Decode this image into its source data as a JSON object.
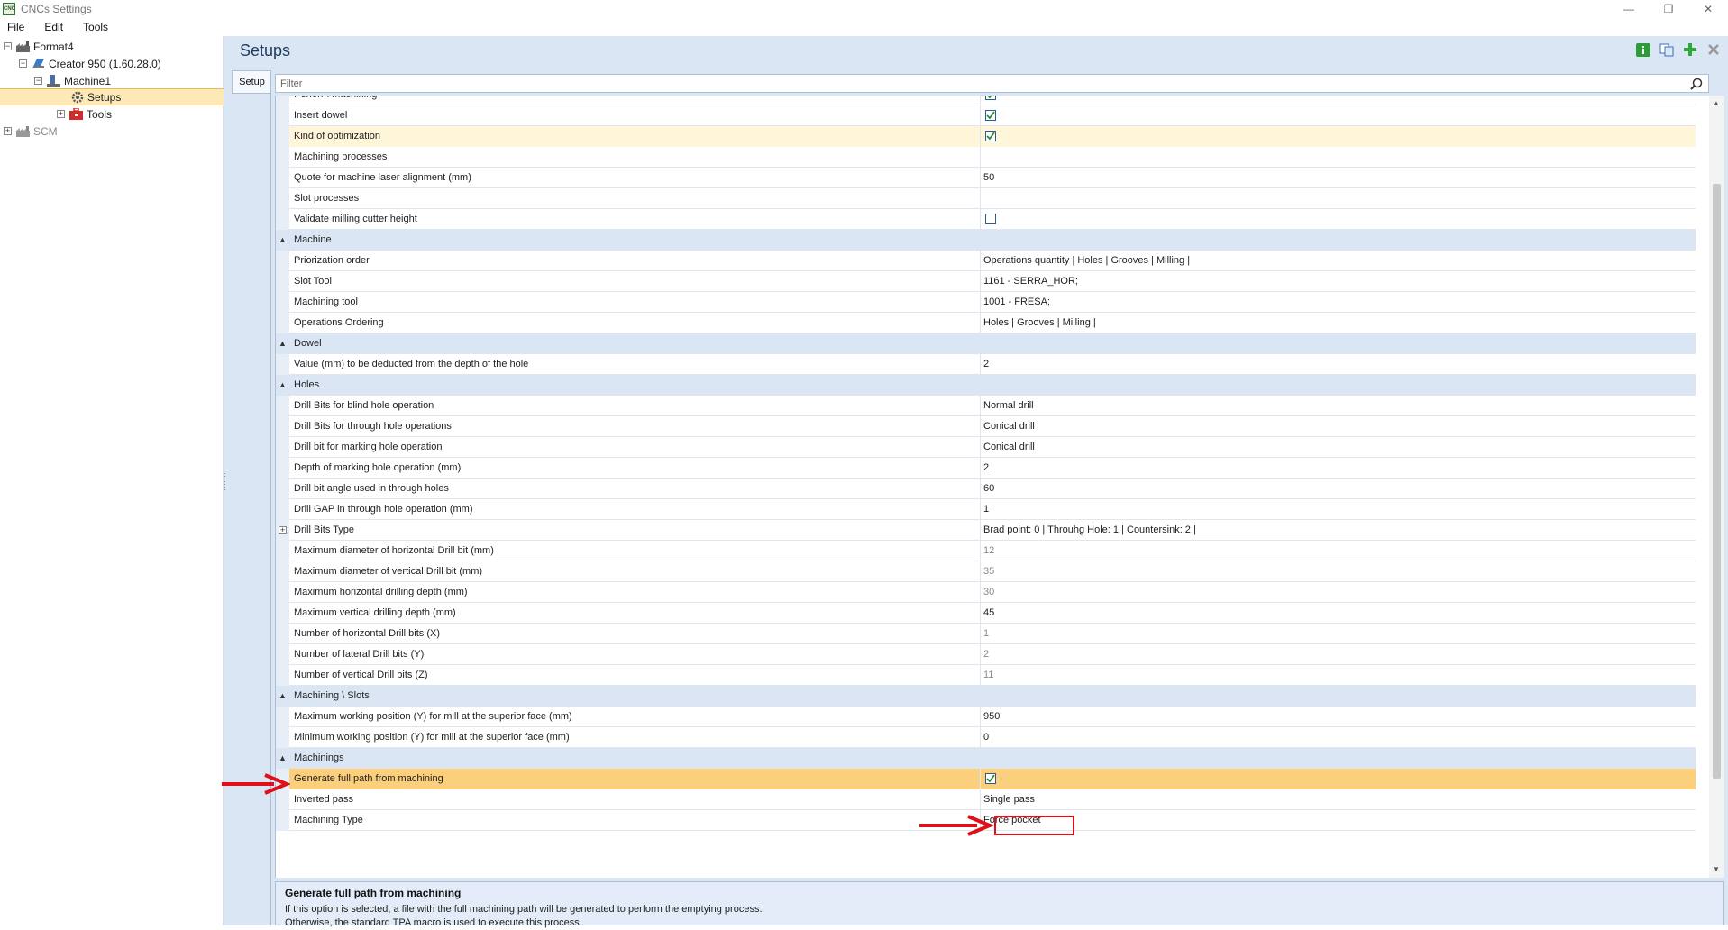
{
  "window": {
    "title": "CNCs Settings",
    "icon_text": "CNC"
  },
  "menu": [
    "File",
    "Edit",
    "Tools"
  ],
  "tree": {
    "format4": "Format4",
    "creator": "Creator 950 (1.60.28.0)",
    "machine": "Machine1",
    "setups": "Setups",
    "tools": "Tools",
    "scm": "SCM"
  },
  "main": {
    "title": "Setups",
    "tab": "Setup",
    "filter_placeholder": "Filter"
  },
  "rows": [
    {
      "type": "prop",
      "name": "Perform machining",
      "check": true
    },
    {
      "type": "prop",
      "name": "Insert dowel",
      "check": true
    },
    {
      "type": "prop",
      "name": "Kind of optimization",
      "check": true,
      "hl": true
    },
    {
      "type": "prop",
      "name": "Machining processes",
      "value": ""
    },
    {
      "type": "prop",
      "name": "Quote for machine laser alignment (mm)",
      "value": "50"
    },
    {
      "type": "prop",
      "name": "Slot processes",
      "value": ""
    },
    {
      "type": "prop",
      "name": "Validate milling cutter height",
      "check": false
    },
    {
      "type": "cat",
      "name": "Machine"
    },
    {
      "type": "prop",
      "name": "Priorization order",
      "value": "Operations quantity | Holes | Grooves | Milling |"
    },
    {
      "type": "prop",
      "name": "Slot Tool",
      "value": "1161 - SERRA_HOR;"
    },
    {
      "type": "prop",
      "name": "Machining tool",
      "value": "1001 - FRESA;"
    },
    {
      "type": "prop",
      "name": "Operations Ordering",
      "value": "Holes | Grooves | Milling |"
    },
    {
      "type": "cat",
      "name": "Dowel"
    },
    {
      "type": "prop",
      "name": "Value (mm) to be deducted from the depth of the hole",
      "value": "2"
    },
    {
      "type": "cat",
      "name": "Holes"
    },
    {
      "type": "prop",
      "name": "Drill Bits for blind hole operation",
      "value": "Normal drill"
    },
    {
      "type": "prop",
      "name": "Drill Bits for through hole operations",
      "value": "Conical drill"
    },
    {
      "type": "prop",
      "name": "Drill bit for marking hole operation",
      "value": "Conical drill"
    },
    {
      "type": "prop",
      "name": "Depth of marking hole operation (mm)",
      "value": "2"
    },
    {
      "type": "prop",
      "name": "Drill bit angle used in through holes",
      "value": "60"
    },
    {
      "type": "prop",
      "name": "Drill GAP in through hole operation (mm)",
      "value": "1"
    },
    {
      "type": "prop",
      "name": "Drill Bits Type",
      "value": "Brad point: 0  |  Throuhg Hole: 1  |  Countersink: 2  |",
      "expand": true
    },
    {
      "type": "prop",
      "name": "Maximum diameter of horizontal Drill bit (mm)",
      "value": "12",
      "grey": true
    },
    {
      "type": "prop",
      "name": "Maximum diameter of vertical Drill bit (mm)",
      "value": "35",
      "grey": true
    },
    {
      "type": "prop",
      "name": "Maximum horizontal drilling depth (mm)",
      "value": "30",
      "grey": true
    },
    {
      "type": "prop",
      "name": "Maximum vertical drilling depth (mm)",
      "value": "45"
    },
    {
      "type": "prop",
      "name": "Number of horizontal Drill bits (X)",
      "value": "1",
      "grey": true
    },
    {
      "type": "prop",
      "name": "Number of lateral Drill bits (Y)",
      "value": "2",
      "grey": true
    },
    {
      "type": "prop",
      "name": "Number of vertical Drill bits (Z)",
      "value": "11",
      "grey": true
    },
    {
      "type": "cat",
      "name": "Machining \\ Slots"
    },
    {
      "type": "prop",
      "name": "Maximum working position (Y) for mill at the superior face (mm)",
      "value": "950"
    },
    {
      "type": "prop",
      "name": "Minimum working position (Y) for mill at the superior face (mm)",
      "value": "0"
    },
    {
      "type": "cat",
      "name": "Machinings"
    },
    {
      "type": "prop",
      "name": "Generate full path from machining",
      "check": true,
      "sel": true
    },
    {
      "type": "prop",
      "name": "Inverted pass",
      "value": "Single pass"
    },
    {
      "type": "prop",
      "name": "Machining Type",
      "value": "Force pocket"
    }
  ],
  "description": {
    "title": "Generate full path from machining",
    "line1": "If this option is selected, a file with the full machining path will be generated to perform the emptying process.",
    "line2": "Otherwise, the standard TPA macro is used to execute this process."
  },
  "colors": {
    "selected_row": "#fbcf7c",
    "category": "#dbe6f4",
    "annotation": "#e0101a"
  }
}
